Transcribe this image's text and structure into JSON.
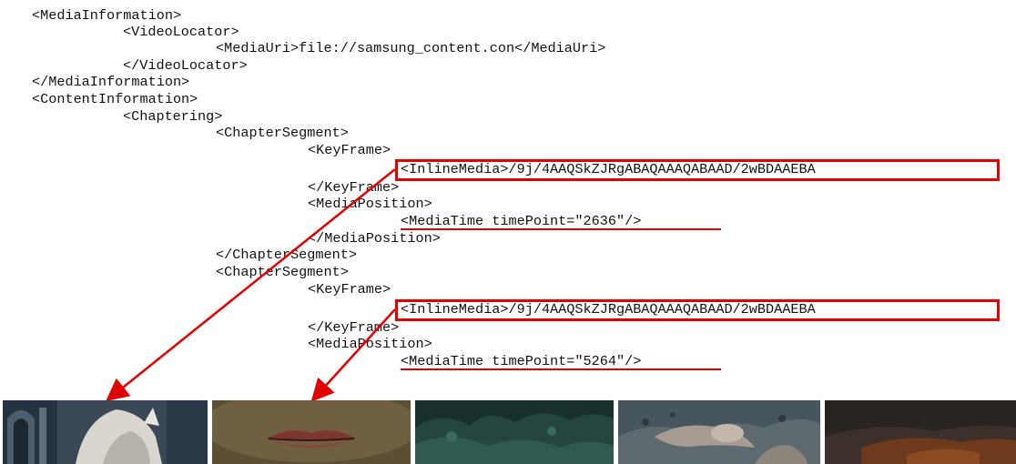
{
  "code_lines": [
    "<MediaInformation>",
    "<VideoLocator>",
    "<MediaUri>file://samsung_content.con</MediaUri>",
    "</VideoLocator>",
    "</MediaInformation>",
    "<ContentInformation>",
    "<Chaptering>",
    "<ChapterSegment>",
    "<KeyFrame>",
    "<InlineMedia>/9j/4AAQSkZJRgABAQAAAQABAAD/2wBDAAEBA",
    "</KeyFrame>",
    "<MediaPosition>",
    "<MediaTime timePoint=\"2636\"/>",
    "</MediaPosition>",
    "</ChapterSegment>",
    "<ChapterSegment>",
    "<KeyFrame>",
    "<InlineMedia>/9j/4AAQSkZJRgABAQAAAQABAAD/2wBDAAEBA",
    "</KeyFrame>",
    "<MediaPosition>",
    "<MediaTime timePoint=\"5264\"/>"
  ],
  "highlights": {
    "inline_media_box_color": "#e00000",
    "media_time_underline_color": "#e00000",
    "arrow_color": "#e00000"
  },
  "thumbnails": [
    {
      "name": "gothic-arch-hooded-figure",
      "palette": [
        "#2f3e4e",
        "#c9c7c0",
        "#5b6b78"
      ]
    },
    {
      "name": "closeup-lips",
      "palette": [
        "#6a5a3c",
        "#8a3a32",
        "#4c4530"
      ]
    },
    {
      "name": "dark-green-forest",
      "palette": [
        "#1c3a36",
        "#2d5048",
        "#132826"
      ]
    },
    {
      "name": "rocky-creature",
      "palette": [
        "#3e4b52",
        "#9a8f86",
        "#6d7478"
      ]
    },
    {
      "name": "dark-landscape-orange",
      "palette": [
        "#2a2420",
        "#7a3c1c",
        "#3b3230"
      ]
    }
  ]
}
